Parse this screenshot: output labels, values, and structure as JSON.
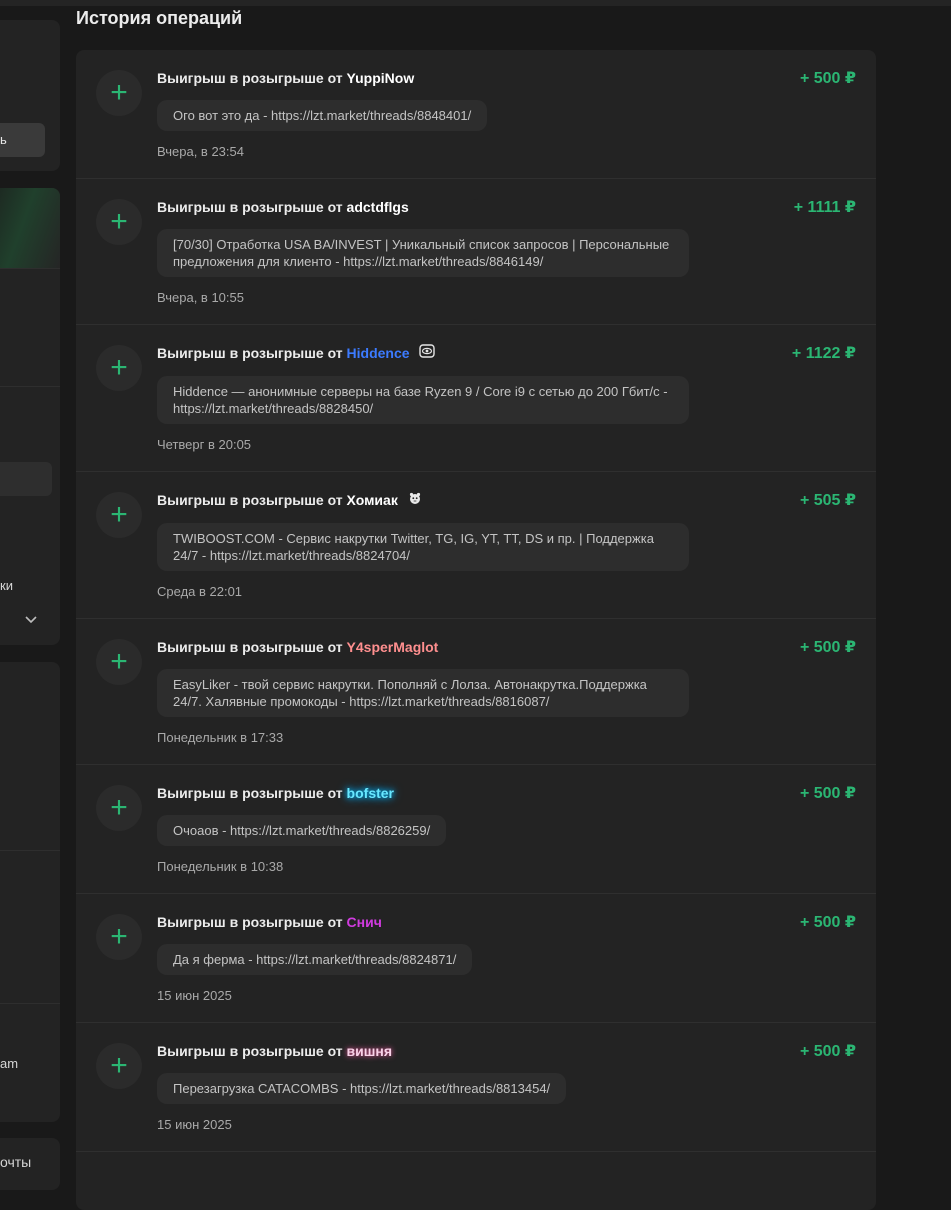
{
  "sidebar": {
    "button_fragment": "ь",
    "text_fragment_1": "ки",
    "text_fragment_2": "am",
    "text_fragment_3": "очты",
    "chevron_icon": "chevron-down-icon"
  },
  "page_title": "История операций",
  "colors": {
    "positive_amount": "#2bb673",
    "plus_icon": "#2bb673"
  },
  "operations": [
    {
      "title_prefix": "Выигрыш в розыгрыше от",
      "user": "YuppiNow",
      "amount": "+ 500 ₽",
      "comment": "Ого вот это да - https://lzt.market/threads/8848401/",
      "date": "Вчера, в 23:54"
    },
    {
      "title_prefix": "Выигрыш в розыгрыше от",
      "user": "adctdflgs",
      "amount": "+ 1111 ₽",
      "comment": "[70/30] Отработка USA BA/INVEST | Уникальный список запросов | Персональные предложения для клиенто - https://lzt.market/threads/8846149/",
      "date": "Вчера, в 10:55"
    },
    {
      "title_prefix": "Выигрыш в розыгрыше от",
      "user": "Hiddence",
      "amount": "+ 1122 ₽",
      "comment": "Hiddence — анонимные серверы на базе Ryzen 9 / Core i9 с сетью до 200 Гбит/с - https://lzt.market/threads/8828450/",
      "date": "Четверг в 20:05"
    },
    {
      "title_prefix": "Выигрыш в розыгрыше от",
      "user": "Хомиак",
      "amount": "+ 505 ₽",
      "comment": "TWIBOOST.COM - Сервис накрутки Twitter, TG, IG, YT, TT, DS и пр. | Поддержка 24/7 - https://lzt.market/threads/8824704/",
      "date": "Среда в 22:01"
    },
    {
      "title_prefix": "Выигрыш в розыгрыше от",
      "user": "Y4sperMaglot",
      "amount": "+ 500 ₽",
      "comment": "EasyLiker - твой сервис накрутки. Пополняй с Лолза. Автонакрутка.Поддержка 24/7. Халявные промокоды - https://lzt.market/threads/8816087/",
      "date": "Понедельник в 17:33"
    },
    {
      "title_prefix": "Выигрыш в розыгрыше от",
      "user": "bofster",
      "amount": "+ 500 ₽",
      "comment": "Очоаов - https://lzt.market/threads/8826259/",
      "date": "Понедельник в 10:38"
    },
    {
      "title_prefix": "Выигрыш в розыгрыше от",
      "user": "Снич",
      "amount": "+ 500 ₽",
      "comment": "Да я ферма - https://lzt.market/threads/8824871/",
      "date": "15 июн 2025"
    },
    {
      "title_prefix": "Выигрыш в розыгрыше от",
      "user": "вишня",
      "amount": "+ 500 ₽",
      "comment": "Перезагрузка CATACOMBS - https://lzt.market/threads/8813454/",
      "date": "15 июн 2025"
    }
  ]
}
